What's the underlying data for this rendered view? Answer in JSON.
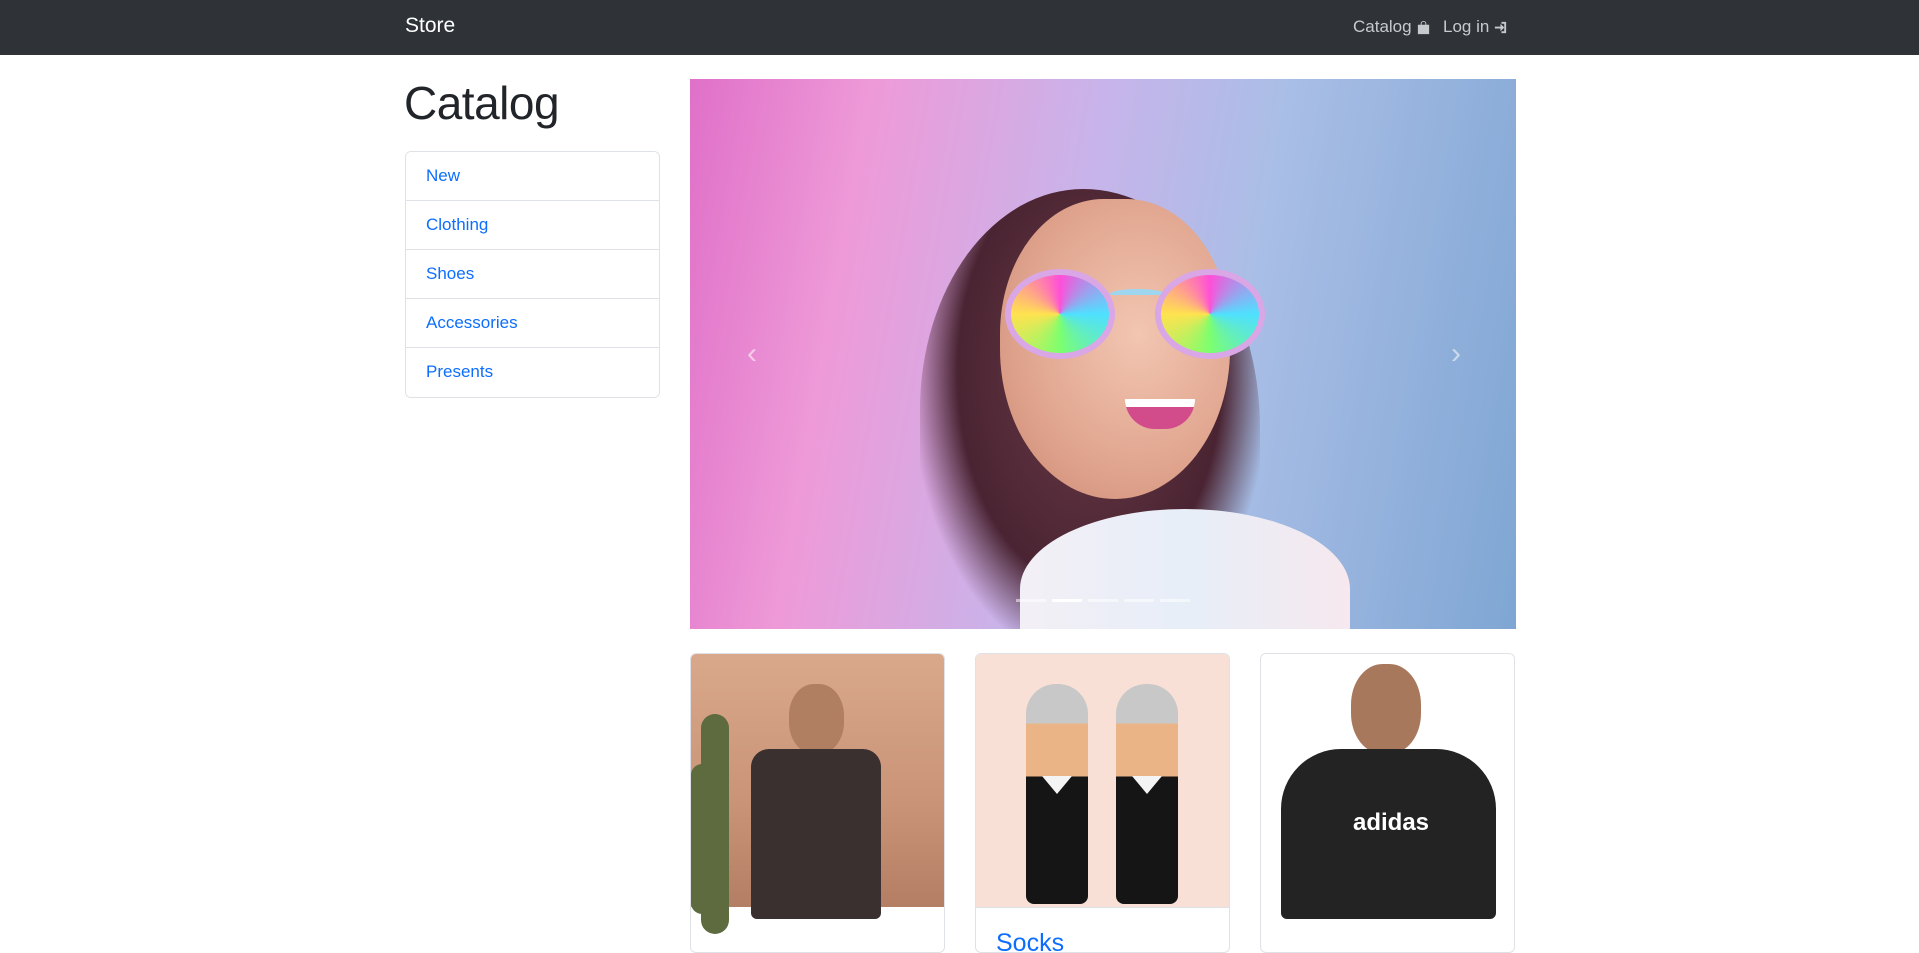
{
  "navbar": {
    "brand": "Store",
    "links": [
      {
        "label": "Catalog",
        "icon": "shopping-bag-icon"
      },
      {
        "label": "Log in",
        "icon": "sign-in-icon"
      }
    ]
  },
  "page": {
    "title": "Catalog"
  },
  "sidebar": {
    "items": [
      {
        "label": "New"
      },
      {
        "label": "Clothing"
      },
      {
        "label": "Shoes"
      },
      {
        "label": "Accessories"
      },
      {
        "label": "Presents"
      }
    ]
  },
  "carousel": {
    "prev_icon": "chevron-left-icon",
    "next_icon": "chevron-right-icon",
    "prev_glyph": "‹",
    "next_glyph": "›",
    "slide_count": 5,
    "active_slide": 2
  },
  "products": [
    {
      "title": "",
      "image": "t-shirt-photo"
    },
    {
      "title": "Socks",
      "image": "socks-photo"
    },
    {
      "title": "",
      "image": "hoodie-photo"
    }
  ],
  "product_logo_text": "adidas",
  "colors": {
    "navbar_bg": "#2f3337",
    "link": "#0d6efd"
  }
}
